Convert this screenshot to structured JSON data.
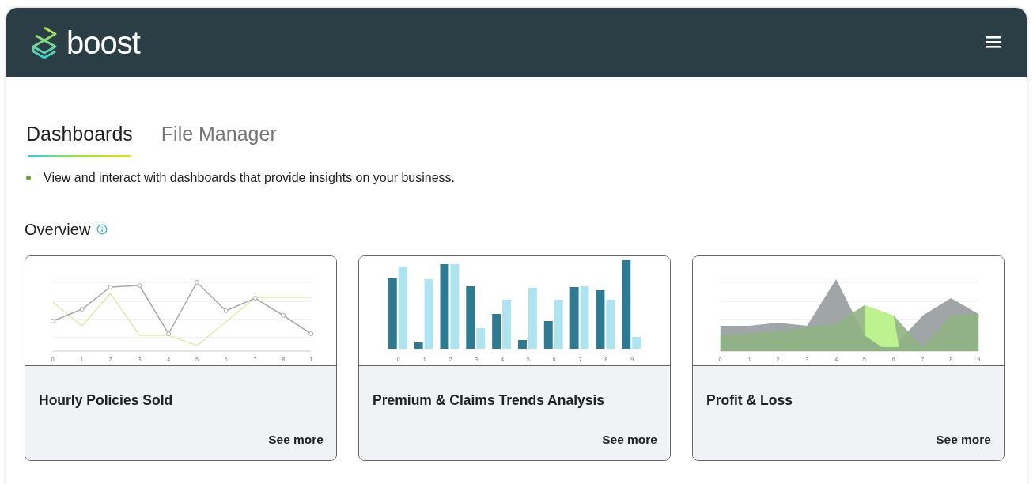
{
  "header": {
    "logo_text": "boost"
  },
  "tabs": [
    {
      "label": "Dashboards",
      "selected": true
    },
    {
      "label": "File Manager",
      "selected": false
    }
  ],
  "description": "View and interact with dashboards that provide insights on your business.",
  "section_title": "Overview",
  "cards": [
    {
      "kind": "line",
      "title": "Hourly Policies Sold",
      "link": "See more",
      "x_labels": [
        "0",
        "1",
        "2",
        "3",
        "4",
        "5",
        "6",
        "7",
        "8",
        "1"
      ]
    },
    {
      "kind": "bar",
      "title": "Premium & Claims Trends Analysis",
      "link": "See more",
      "x_labels": [
        "0",
        "1",
        "2",
        "3",
        "4",
        "5",
        "6",
        "7",
        "8",
        "9"
      ]
    },
    {
      "kind": "area",
      "title": "Profit & Loss",
      "link": "See more",
      "x_labels": [
        "0",
        "1",
        "2",
        "3",
        "4",
        "5",
        "6",
        "7",
        "8",
        "9"
      ]
    }
  ]
}
